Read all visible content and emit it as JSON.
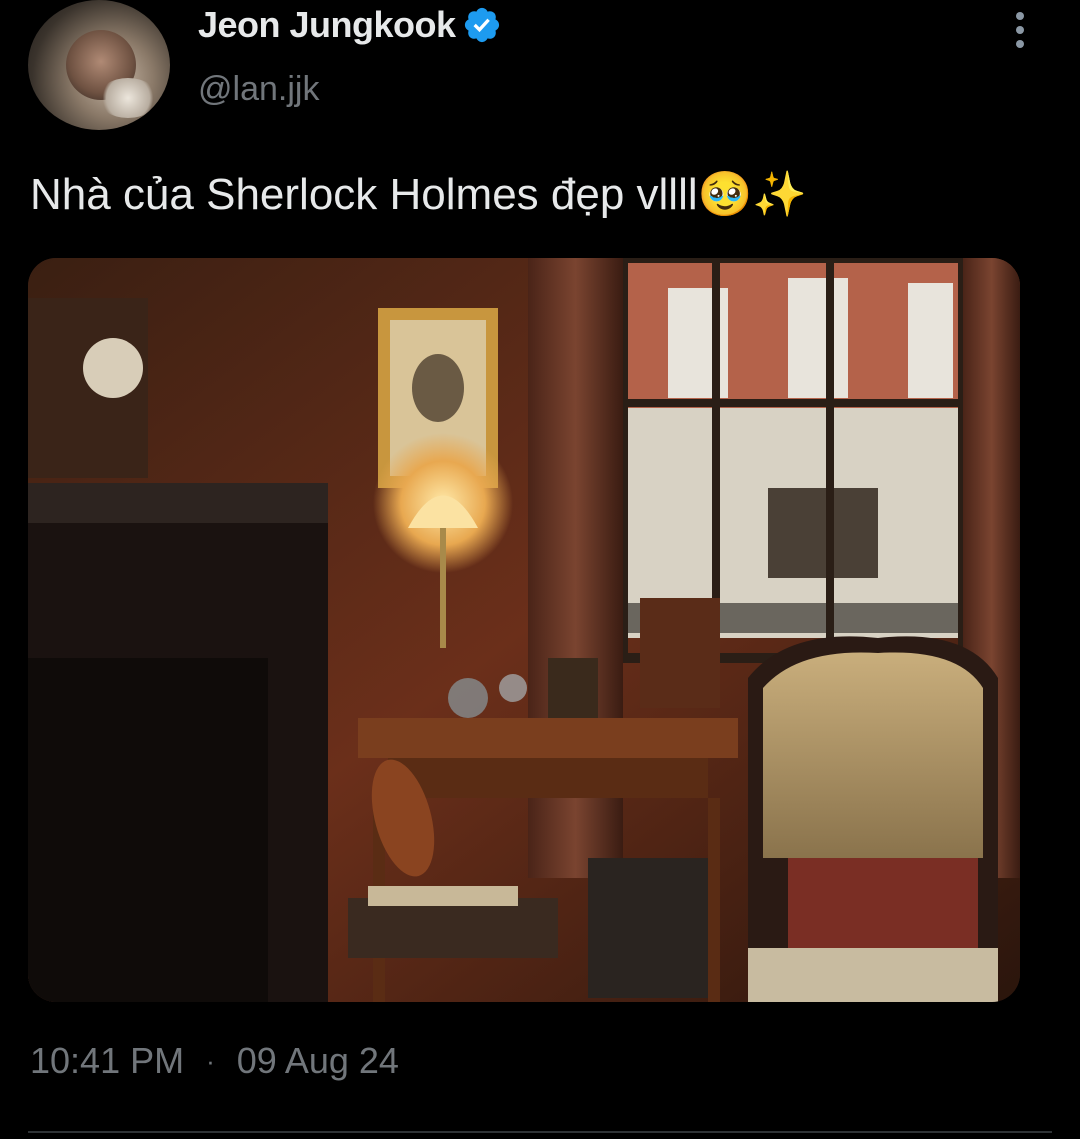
{
  "tweet": {
    "author_name": "Jeon Jungkook",
    "author_handle": "@lan.jjk",
    "text": "Nhà của Sherlock Holmes đẹp vllll🥹✨",
    "time": "10:41 PM",
    "separator": "·",
    "date": "09 Aug 24"
  },
  "media": {
    "description_icon": "photo-image"
  },
  "colors": {
    "background": "#000000",
    "primary_text": "#e7e9ea",
    "secondary_text": "#71767b",
    "verified": "#1d9bf0"
  }
}
